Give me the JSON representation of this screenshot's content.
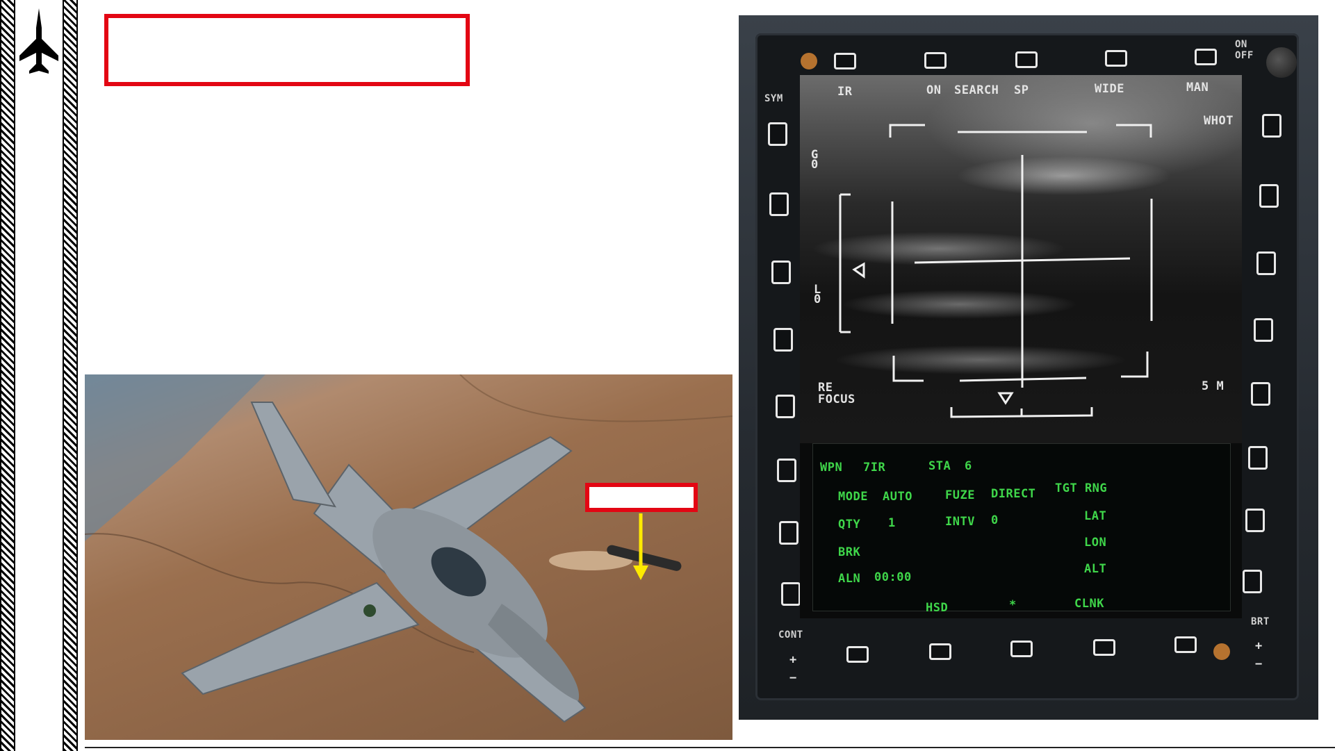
{
  "photo": {
    "callout_color": "#e30613",
    "arrow_color": "#ffea00"
  },
  "mfd": {
    "top_labels": {
      "ir": "IR",
      "on": "ON",
      "search": "SEARCH",
      "sp": "SP",
      "wide": "WIDE",
      "man": "MAN"
    },
    "sym": "SYM",
    "on_off": "ON\nOFF",
    "cont": "CONT",
    "brt": "BRT",
    "plus": "+",
    "minus": "−",
    "right_labels": {
      "whot": "WHOT",
      "range": "5 M"
    },
    "left_labels": {
      "g": "G\n0",
      "l": "L\n0",
      "refocus": "RE\nFOCUS"
    },
    "weapon": {
      "wpn_label": "WPN",
      "wpn_value": "7IR",
      "sta_label": "STA",
      "sta_value": "6",
      "mode_label": "MODE",
      "mode_value": "AUTO",
      "fuze_label": "FUZE",
      "fuze_value": "DIRECT",
      "tgt_rng": "TGT RNG",
      "qty_label": "QTY",
      "qty_value": "1",
      "intv_label": "INTV",
      "intv_value": "0",
      "lat": "LAT",
      "lon": "LON",
      "alt": "ALT",
      "brk": "BRK",
      "aln_label": "ALN",
      "aln_value": "00:00",
      "hsd": "HSD",
      "star": "*",
      "clnk": "CLNK"
    },
    "colors": {
      "symbology": "#e4e4e4",
      "data_text": "#3fd64a"
    }
  }
}
